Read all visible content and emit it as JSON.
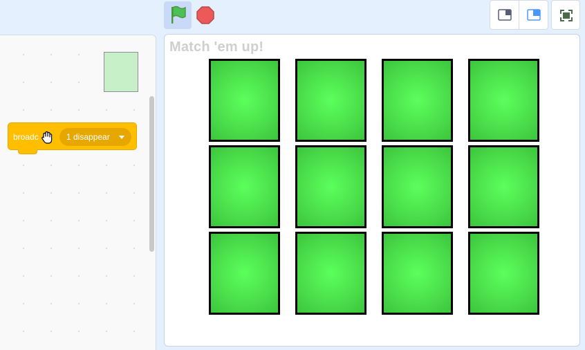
{
  "toolbar": {
    "green_flag_icon": "green-flag-icon",
    "stop_icon": "stop-sign-icon",
    "small_stage_icon": "small-stage-icon",
    "large_stage_icon": "large-stage-icon",
    "fullscreen_icon": "fullscreen-icon",
    "flag_active_bg": "#c8daf8"
  },
  "code_area": {
    "block": {
      "label": "broadcast",
      "label_visible": "broadc",
      "dropdown_value": "1 disappear",
      "color": "#ffbf00"
    }
  },
  "stage": {
    "title": "Match 'em up!",
    "cards": [
      {
        "row": 1,
        "col": 1
      },
      {
        "row": 1,
        "col": 2
      },
      {
        "row": 1,
        "col": 3
      },
      {
        "row": 1,
        "col": 4
      },
      {
        "row": 2,
        "col": 1
      },
      {
        "row": 2,
        "col": 2
      },
      {
        "row": 2,
        "col": 3
      },
      {
        "row": 2,
        "col": 4
      },
      {
        "row": 3,
        "col": 1
      },
      {
        "row": 3,
        "col": 2
      },
      {
        "row": 3,
        "col": 3
      },
      {
        "row": 3,
        "col": 4
      }
    ],
    "card_color": "#4ce04c"
  }
}
